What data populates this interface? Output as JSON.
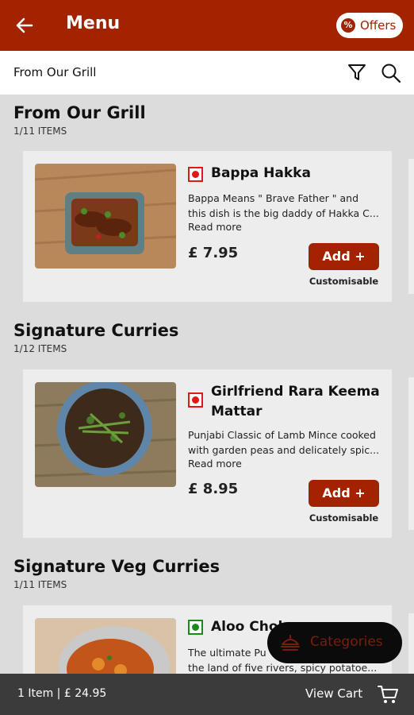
{
  "header": {
    "title": "Menu",
    "offers_label": "Offers",
    "offers_icon": "percent-badge-icon",
    "back_icon": "arrow-left-icon"
  },
  "subheader": {
    "title": "From Our Grill",
    "filter_icon": "filter-icon",
    "search_icon": "search-icon"
  },
  "sections": [
    {
      "title": "From Our Grill",
      "count": "1/11 ITEMS",
      "item": {
        "name": "Bappa Hakka",
        "diet": "non-veg",
        "description_lines": [
          "Bappa Means \" Brave Father \" and",
          "this dish is the big daddy of Hakka C..."
        ],
        "read_more": "Read more",
        "price": "£ 7.95",
        "add_label": "Add +",
        "customisable": "Customisable"
      }
    },
    {
      "title": "Signature Curries",
      "count": "1/12 ITEMS",
      "item": {
        "name": "Girlfriend Rara Keema Mattar",
        "diet": "non-veg",
        "description_lines": [
          "Punjabi Classic of Lamb Mince cooked",
          "with garden peas and delicately spic..."
        ],
        "read_more": "Read more",
        "price": "£ 8.95",
        "add_label": "Add +",
        "customisable": "Customisable"
      }
    },
    {
      "title": "Signature Veg Curries",
      "count": "1/11 ITEMS",
      "item": {
        "name": "Aloo Chok",
        "diet": "veg",
        "description_lines": [
          "The ultimate Pu",
          "the land of five rivers, spicy potatoe..."
        ]
      }
    }
  ],
  "categories_button": {
    "label": "Categories",
    "icon": "food-menu-icon"
  },
  "cart_bar": {
    "summary": "1 Item | £ 24.95",
    "view_cart": "View Cart",
    "cart_icon": "cart-icon"
  },
  "colors": {
    "brand": "#a32300",
    "veg": "#1a8a1a",
    "non_veg": "#e01818",
    "bottom_bar": "#3b3b3b"
  }
}
